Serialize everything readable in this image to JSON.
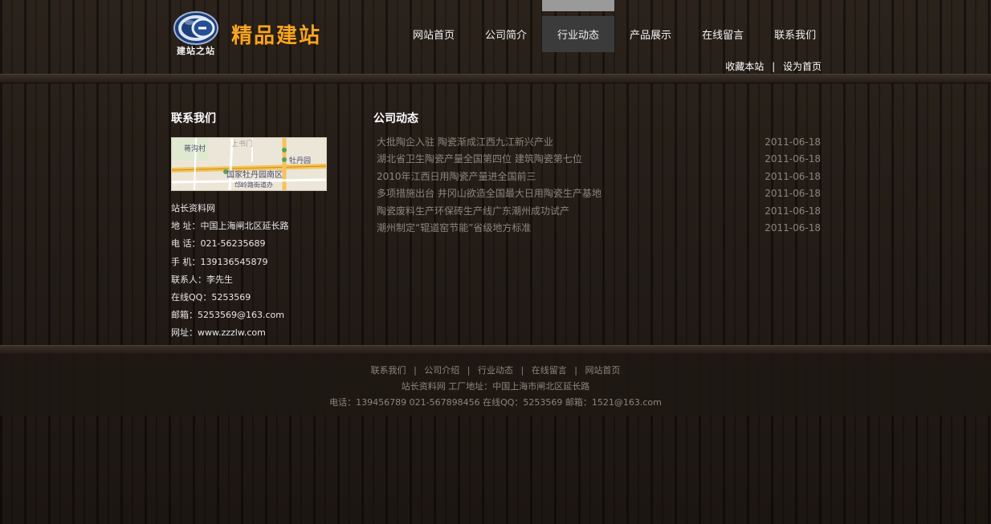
{
  "header": {
    "logo_tag": "建站之站",
    "logo_title": "精品建站",
    "nav": [
      {
        "label": "网站首页"
      },
      {
        "label": "公司简介"
      },
      {
        "label": "行业动态"
      },
      {
        "label": "产品展示"
      },
      {
        "label": "在线留言"
      },
      {
        "label": "联系我们"
      }
    ],
    "active_nav": "行业动态",
    "top_links": {
      "bookmark": "收藏本站",
      "separator": "|",
      "homepage": "设为首页"
    }
  },
  "sidebar": {
    "title": "联系我们",
    "map_labels": {
      "village": "蒋沟村",
      "north": "上书门",
      "park": "牡丹园",
      "park_south": "国家牡丹园南区",
      "street": "邙岭路街道办"
    },
    "contact": [
      "站长资料网",
      "地 址：中国上海闸北区延长路",
      "电 话：021-56235689",
      "手 机：139136545879",
      "联系人：李先生",
      "在线QQ：5253569",
      "邮箱：5253569@163.com",
      "网址：www.zzzlw.com"
    ]
  },
  "news": {
    "title": "公司动态",
    "items": [
      {
        "title": "大批陶企入驻 陶瓷渐成江西九江新兴产业",
        "date": "2011-06-18"
      },
      {
        "title": "湖北省卫生陶瓷产量全国第四位 建筑陶瓷第七位",
        "date": "2011-06-18"
      },
      {
        "title": "2010年江西日用陶瓷产量进全国前三",
        "date": "2011-06-18"
      },
      {
        "title": "多项措施出台 井冈山欲造全国最大日用陶瓷生产基地",
        "date": "2011-06-18"
      },
      {
        "title": "陶瓷废料生产环保砖生产线广东潮州成功试产",
        "date": "2011-06-18"
      },
      {
        "title": "潮州制定“辊道窑节能”省级地方标准",
        "date": "2011-06-18"
      }
    ]
  },
  "footer": {
    "links": [
      {
        "label": "联系我们"
      },
      {
        "label": "公司介绍"
      },
      {
        "label": "行业动态"
      },
      {
        "label": "在线留言"
      },
      {
        "label": "网站首页"
      }
    ],
    "separator": "|",
    "line1": "站长资料网 工厂地址：中国上海市闸北区延长路",
    "line2": "电话：139456789 021-567898456 在线QQ：5253569 邮箱：1521@163.com"
  },
  "colors": {
    "background": "#1b1510",
    "logo_orange": "#f5a623",
    "nav_active": "#3b3b3b",
    "muted_text": "#8c847a"
  },
  "icons": {
    "logo": "cg-globe-emblem",
    "map": "location-map-thumbnail"
  }
}
